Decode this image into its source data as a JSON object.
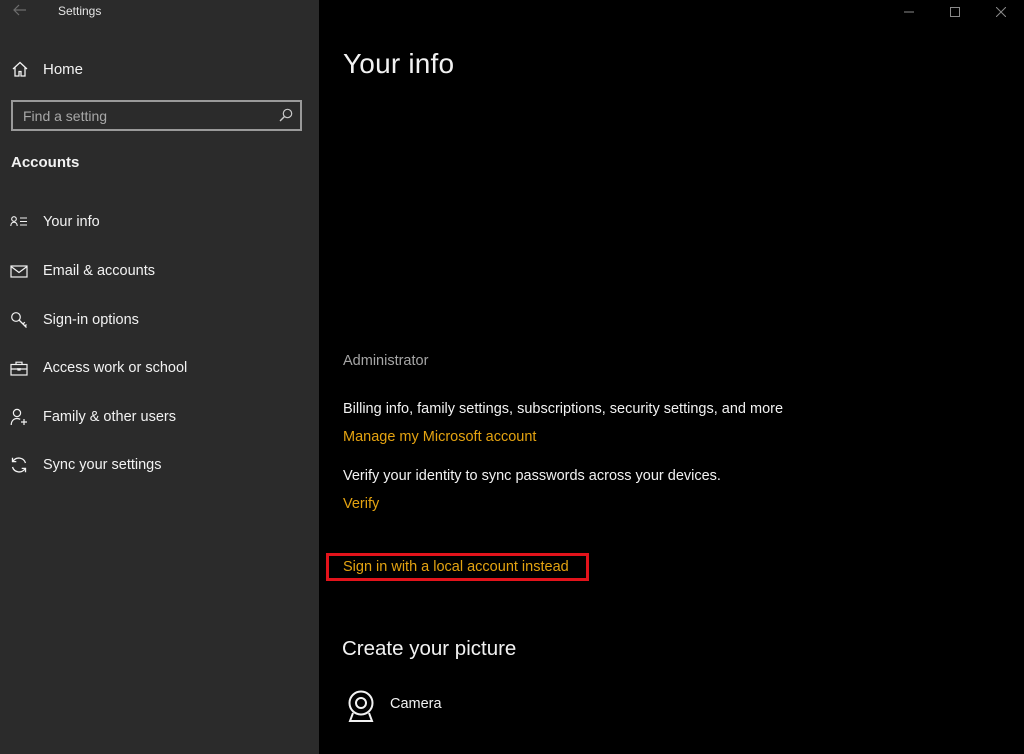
{
  "window": {
    "title": "Settings",
    "back_icon": "back-arrow-icon",
    "controls": [
      "minimize-icon",
      "maximize-icon",
      "close-icon"
    ]
  },
  "sidebar": {
    "home": {
      "label": "Home",
      "icon": "home-icon"
    },
    "search": {
      "placeholder": "Find a setting",
      "value": "",
      "icon": "search-icon"
    },
    "section_title": "Accounts",
    "items": [
      {
        "label": "Your info",
        "icon": "person-card-icon",
        "selected": true
      },
      {
        "label": "Email & accounts",
        "icon": "mail-icon"
      },
      {
        "label": "Sign-in options",
        "icon": "key-icon"
      },
      {
        "label": "Access work or school",
        "icon": "briefcase-icon"
      },
      {
        "label": "Family & other users",
        "icon": "add-person-icon"
      },
      {
        "label": "Sync your settings",
        "icon": "sync-icon"
      }
    ]
  },
  "main": {
    "title": "Your info",
    "account_name": "Administrator",
    "billing_text": "Billing info, family settings, subscriptions, security settings, and more",
    "manage_link": "Manage my Microsoft account",
    "verify_text": "Verify your identity to sync passwords across your devices.",
    "verify_link": "Verify",
    "local_account_link": "Sign in with a local account instead",
    "picture_title": "Create your picture",
    "camera_label": "Camera",
    "colors": {
      "accent_link": "#e4a311",
      "highlight_box": "#e3131b",
      "sidebar_bg": "#2b2b2b",
      "main_bg": "#000000"
    }
  }
}
